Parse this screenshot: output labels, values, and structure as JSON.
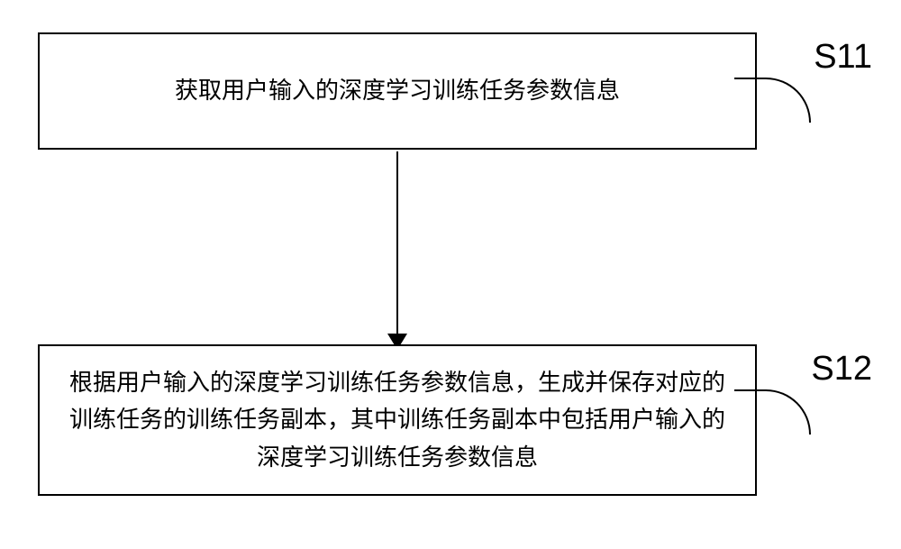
{
  "steps": {
    "s11": {
      "label": "S11",
      "text": "获取用户输入的深度学习训练任务参数信息"
    },
    "s12": {
      "label": "S12",
      "text": "根据用户输入的深度学习训练任务参数信息，生成并保存对应的训练任务的训练任务副本，其中训练任务副本中包括用户输入的深度学习训练任务参数信息"
    }
  }
}
